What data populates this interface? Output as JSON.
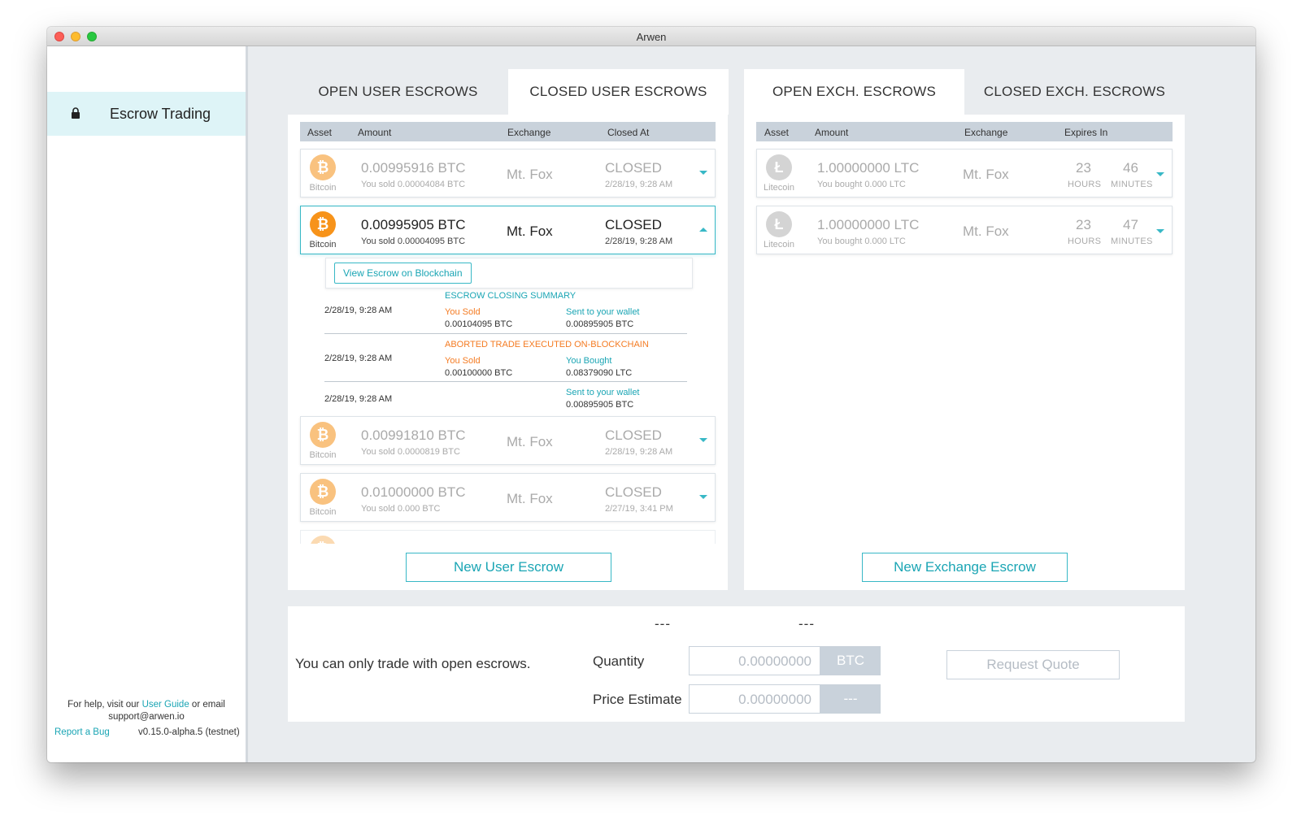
{
  "window": {
    "title": "Arwen"
  },
  "sidebar": {
    "item_label": "Escrow Trading",
    "help_prefix": "For help, visit our ",
    "help_link": "User Guide",
    "help_suffix": " or email",
    "help_email": "support@arwen.io",
    "report_bug": "Report a Bug",
    "version": "v0.15.0-alpha.5 (testnet)"
  },
  "user_panel": {
    "tabs": [
      "OPEN USER ESCROWS",
      "CLOSED USER ESCROWS"
    ],
    "active_tab": "CLOSED USER ESCROWS",
    "headers": {
      "asset": "Asset",
      "amount": "Amount",
      "exchange": "Exchange",
      "closed_at": "Closed At"
    },
    "rows": [
      {
        "coin": "Bitcoin",
        "amount": "0.00995916 BTC",
        "sub": "You sold 0.00004084 BTC",
        "exchange": "Mt. Fox",
        "status": "CLOSED",
        "date": "2/28/19, 9:28 AM"
      },
      {
        "coin": "Bitcoin",
        "amount": "0.00995905 BTC",
        "sub": "You sold 0.00004095 BTC",
        "exchange": "Mt. Fox",
        "status": "CLOSED",
        "date": "2/28/19, 9:28 AM"
      },
      {
        "coin": "Bitcoin",
        "amount": "0.00991810 BTC",
        "sub": "You sold 0.0000819 BTC",
        "exchange": "Mt. Fox",
        "status": "CLOSED",
        "date": "2/28/19, 9:28 AM"
      },
      {
        "coin": "Bitcoin",
        "amount": "0.01000000 BTC",
        "sub": "You sold 0.000 BTC",
        "exchange": "Mt. Fox",
        "status": "CLOSED",
        "date": "2/27/19, 3:41 PM"
      }
    ],
    "detail": {
      "view_button": "View Escrow on Blockchain",
      "summary_title": "ESCROW CLOSING SUMMARY",
      "e1_date": "2/28/19, 9:28 AM",
      "e1_left_label": "You Sold",
      "e1_left_value": "0.00104095 BTC",
      "e1_right_label": "Sent to your wallet",
      "e1_right_value": "0.00895905 BTC",
      "aborted_title": "ABORTED TRADE EXECUTED ON-BLOCKCHAIN",
      "e2_date": "2/28/19, 9:28 AM",
      "e2_left_label": "You Sold",
      "e2_left_value": "0.00100000 BTC",
      "e2_right_label": "You Bought",
      "e2_right_value": "0.08379090 LTC",
      "e3_date": "2/28/19, 9:28 AM",
      "e3_right_label": "Sent to your wallet",
      "e3_right_value": "0.00895905 BTC"
    },
    "new_button": "New User Escrow"
  },
  "exch_panel": {
    "tabs": [
      "OPEN EXCH. ESCROWS",
      "CLOSED EXCH. ESCROWS"
    ],
    "active_tab": "OPEN EXCH. ESCROWS",
    "headers": {
      "asset": "Asset",
      "amount": "Amount",
      "exchange": "Exchange",
      "expires_in": "Expires In"
    },
    "rows": [
      {
        "coin": "Litecoin",
        "amount": "1.00000000 LTC",
        "sub": "You bought 0.000 LTC",
        "exchange": "Mt. Fox",
        "hours": "23",
        "hours_label": "HOURS",
        "minutes": "46",
        "minutes_label": "MINUTES"
      },
      {
        "coin": "Litecoin",
        "amount": "1.00000000 LTC",
        "sub": "You bought 0.000 LTC",
        "exchange": "Mt. Fox",
        "hours": "23",
        "hours_label": "HOURS",
        "minutes": "47",
        "minutes_label": "MINUTES"
      }
    ],
    "new_button": "New Exchange Escrow"
  },
  "trade": {
    "dash_left": "---",
    "dash_right": "---",
    "note": "You can only trade with open escrows.",
    "quantity_label": "Quantity",
    "quantity_placeholder": "0.00000000",
    "quantity_unit": "BTC",
    "price_label": "Price Estimate",
    "price_placeholder": "0.00000000",
    "price_unit": "---",
    "request_button": "Request Quote"
  },
  "colors": {
    "accent": "#38b8c6",
    "btc": "#f7931a",
    "orange_text": "#f47b22",
    "sidebar_active": "#def4f7"
  }
}
